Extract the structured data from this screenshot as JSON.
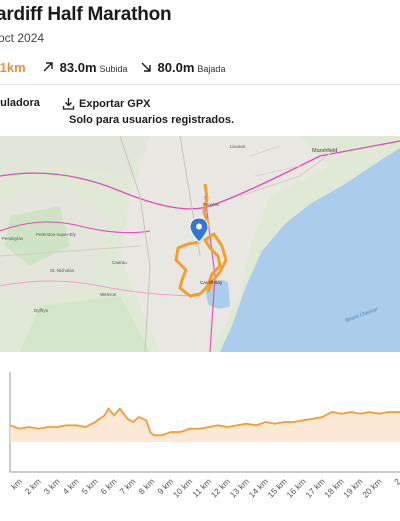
{
  "header": {
    "title": "ardiff Half Marathon",
    "date": "oct 2024"
  },
  "stats": {
    "distance": ".1km",
    "ascent_value": "83.0m",
    "ascent_label": "Subida",
    "descent_value": "80.0m",
    "descent_label": "Bajada"
  },
  "actions": {
    "calculator_label": "culadora",
    "export_label": "Exportar GPX",
    "export_note": "Solo para usuarios registrados."
  },
  "map": {
    "place_labels": [
      "Marshfield",
      "Penylan",
      "Cardiff Bay",
      "Bristol Channel",
      "St. Nicholas",
      "Peterston-super-Ely",
      "Pendoylan",
      "Dyffryn",
      "Wenvoe",
      "Lisvane",
      "Caerau"
    ],
    "colors": {
      "route": "#f0a030",
      "water": "#a8cdea",
      "land": "#dfe9d6",
      "urban": "#e8e6e1",
      "motorway": "#e04bb0"
    }
  },
  "chart_data": {
    "type": "area",
    "title": "",
    "xlabel": "",
    "ylabel": "",
    "x_tick_labels": [
      "km",
      "2 km",
      "3 km",
      "4 km",
      "5 km",
      "6 km",
      "7 km",
      "8 km",
      "9 km",
      "10 km",
      "11 km",
      "12 km",
      "13 km",
      "14 km",
      "15 km",
      "16 km",
      "17 km",
      "18 km",
      "19 km",
      "20 km",
      "2"
    ],
    "xlim": [
      0.5,
      21.1
    ],
    "ylim": [
      0,
      60
    ],
    "x": [
      0.5,
      1,
      1.5,
      2,
      2.5,
      3,
      3.5,
      4,
      4.5,
      5,
      5.5,
      5.7,
      6,
      6.3,
      6.7,
      7,
      7.3,
      7.7,
      7.9,
      8.1,
      8.5,
      9,
      9.5,
      10,
      10.5,
      11,
      11.5,
      12,
      12.5,
      13,
      13.5,
      14,
      14.5,
      15,
      15.5,
      16,
      16.5,
      17,
      17.5,
      18,
      18.5,
      19,
      19.5,
      20,
      20.5,
      21.1
    ],
    "y": [
      28,
      26,
      27,
      26,
      27,
      27,
      28,
      28,
      27,
      30,
      34,
      38,
      34,
      38,
      32,
      30,
      33,
      31,
      24,
      22,
      22,
      24,
      24,
      26,
      26,
      27,
      28,
      27,
      28,
      29,
      28,
      30,
      29,
      30,
      30,
      31,
      32,
      33,
      36,
      35,
      36,
      35,
      36,
      35,
      36,
      36
    ],
    "colors": {
      "line": "#f39c32",
      "fill": "#fbe3cb"
    },
    "grid": false
  }
}
